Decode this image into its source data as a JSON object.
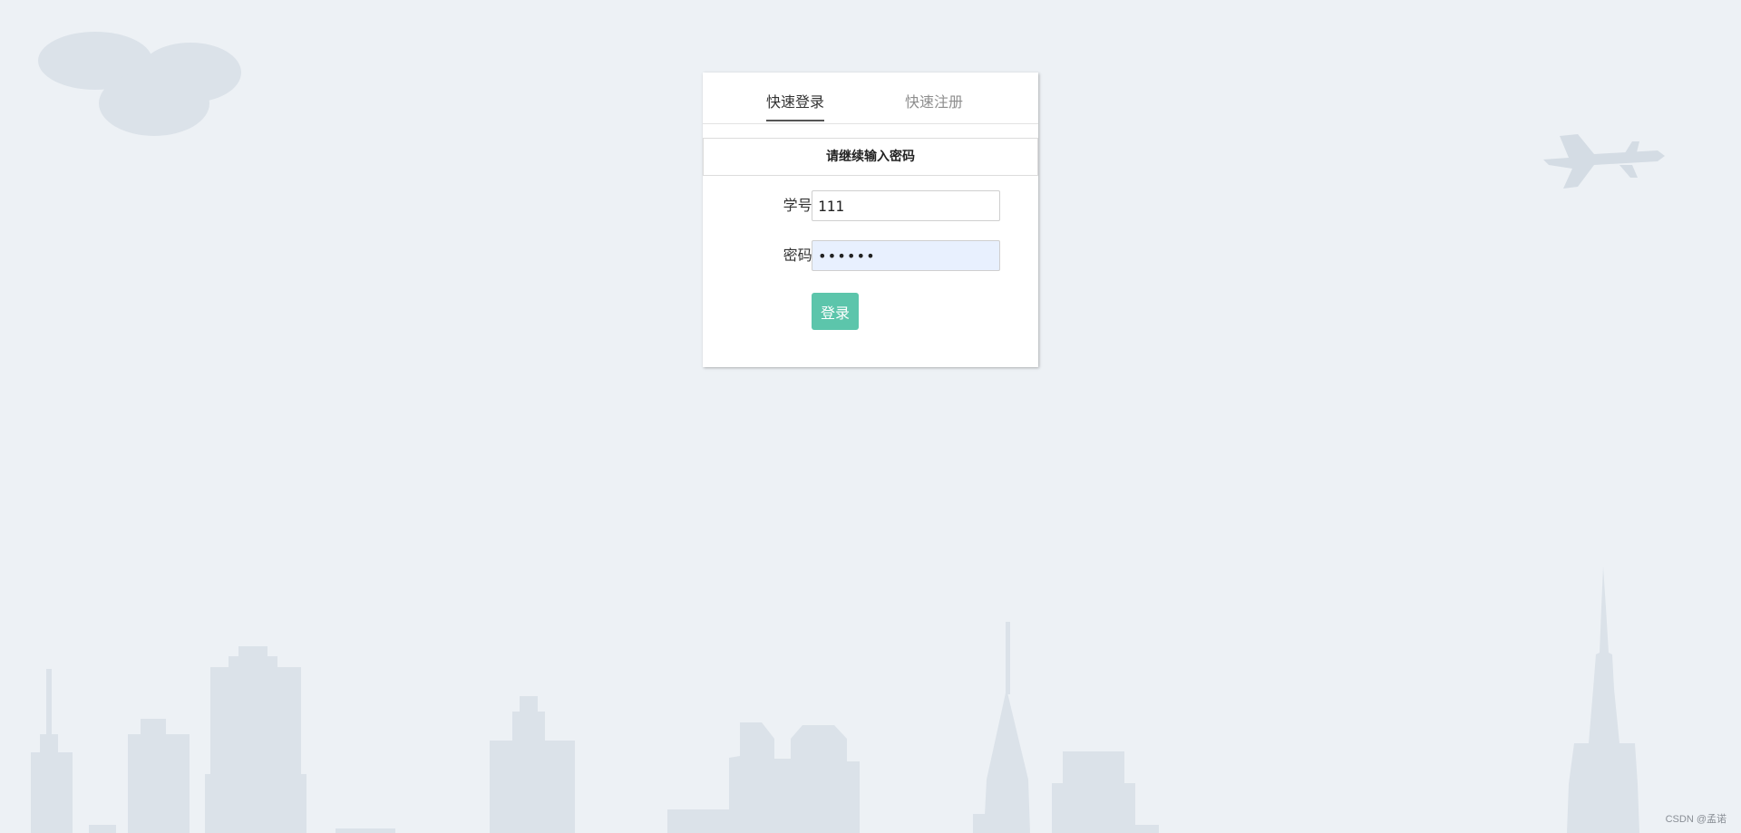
{
  "tabs": {
    "login_label": "快速登录",
    "register_label": "快速注册",
    "active": "login"
  },
  "notice": {
    "text": "请继续输入密码"
  },
  "form": {
    "id_label": "学号:",
    "id_value": "111",
    "password_label": "密码:",
    "password_value": "••••••"
  },
  "buttons": {
    "login_label": "登录"
  },
  "watermark": {
    "text": "CSDN @孟诺"
  },
  "colors": {
    "background": "#edf1f5",
    "skyline": "#dbe2e9",
    "accent": "#5cc5ab",
    "autofill": "#e8f0fe"
  },
  "icons": {
    "cloud": "cloud-icon",
    "plane": "airplane-icon",
    "skyline": "city-skyline"
  }
}
